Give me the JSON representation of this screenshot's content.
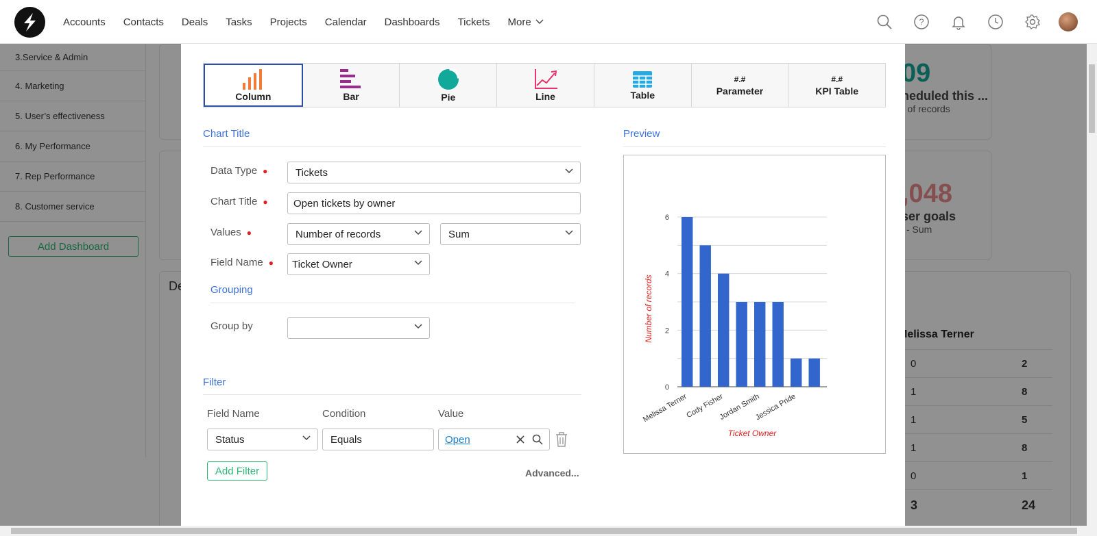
{
  "topbar": {
    "nav": [
      "Accounts",
      "Contacts",
      "Deals",
      "Tasks",
      "Projects",
      "Calendar",
      "Dashboards",
      "Tickets"
    ],
    "more_label": "More",
    "icons": [
      "search-icon",
      "help-icon",
      "bell-icon",
      "clock-icon",
      "gear-icon"
    ]
  },
  "sidebar": {
    "items": [
      "3.Service & Admin",
      "4. Marketing",
      "5. User’s effectiveness",
      "6. My Performance",
      "7. Rep Performance",
      "8. Customer service"
    ],
    "add_label": "Add Dashboard"
  },
  "background": {
    "card1_value": "09",
    "card1_title": "neduled this ...",
    "card1_sub": "r of records",
    "card2_value": ",048",
    "card2_title": "ser goals",
    "card2_sub": "l - Sum",
    "section_heading": "De",
    "table_header": "Melissa Terner",
    "table_rows": [
      [
        "0",
        "2"
      ],
      [
        "1",
        "8"
      ],
      [
        "1",
        "5"
      ],
      [
        "1",
        "8"
      ],
      [
        "0",
        "1"
      ],
      [
        "3",
        "24"
      ]
    ]
  },
  "modal": {
    "chart_types": [
      {
        "label": "Column",
        "icon": "column-chart-icon",
        "active": true
      },
      {
        "label": "Bar",
        "icon": "bar-chart-icon"
      },
      {
        "label": "Pie",
        "icon": "pie-chart-icon"
      },
      {
        "label": "Line",
        "icon": "line-chart-icon"
      },
      {
        "label": "Table",
        "icon": "table-icon"
      },
      {
        "label": "Parameter",
        "icon": "#.#"
      },
      {
        "label": "KPI Table",
        "icon": "#.#"
      }
    ],
    "chart_title_section": "Chart Title",
    "preview_section": "Preview",
    "data_type_label": "Data Type",
    "data_type_value": "Tickets",
    "chart_title_label": "Chart Title",
    "chart_title_value": "Open tickets by owner",
    "values_label": "Values",
    "values_field": "Number of records",
    "values_agg": "Sum",
    "field_name_label": "Field Name",
    "field_name_value": "Ticket Owner",
    "grouping_section": "Grouping",
    "group_by_label": "Group by",
    "group_by_value": "",
    "filter_section": "Filter",
    "filter_headers": [
      "Field Name",
      "Condition",
      "Value"
    ],
    "filter_field": "Status",
    "filter_condition": "Equals",
    "filter_value": "Open",
    "add_filter_label": "Add Filter",
    "advanced_label": "Advanced..."
  },
  "chart_data": {
    "type": "bar",
    "categories": [
      "Melissa Terner",
      "",
      "Cody Fisher",
      "",
      "Jordan Smith",
      "",
      "Jessica Pride",
      ""
    ],
    "values": [
      6,
      5,
      4,
      3,
      3,
      3,
      1,
      1
    ],
    "xlabel": "Ticket Owner",
    "ylabel": "Number of records",
    "ylim": [
      0,
      6
    ],
    "yticks": [
      "0",
      "2",
      "4",
      "6"
    ],
    "bar_color": "#3366cc",
    "label_color": "#e02020",
    "grid": true
  }
}
